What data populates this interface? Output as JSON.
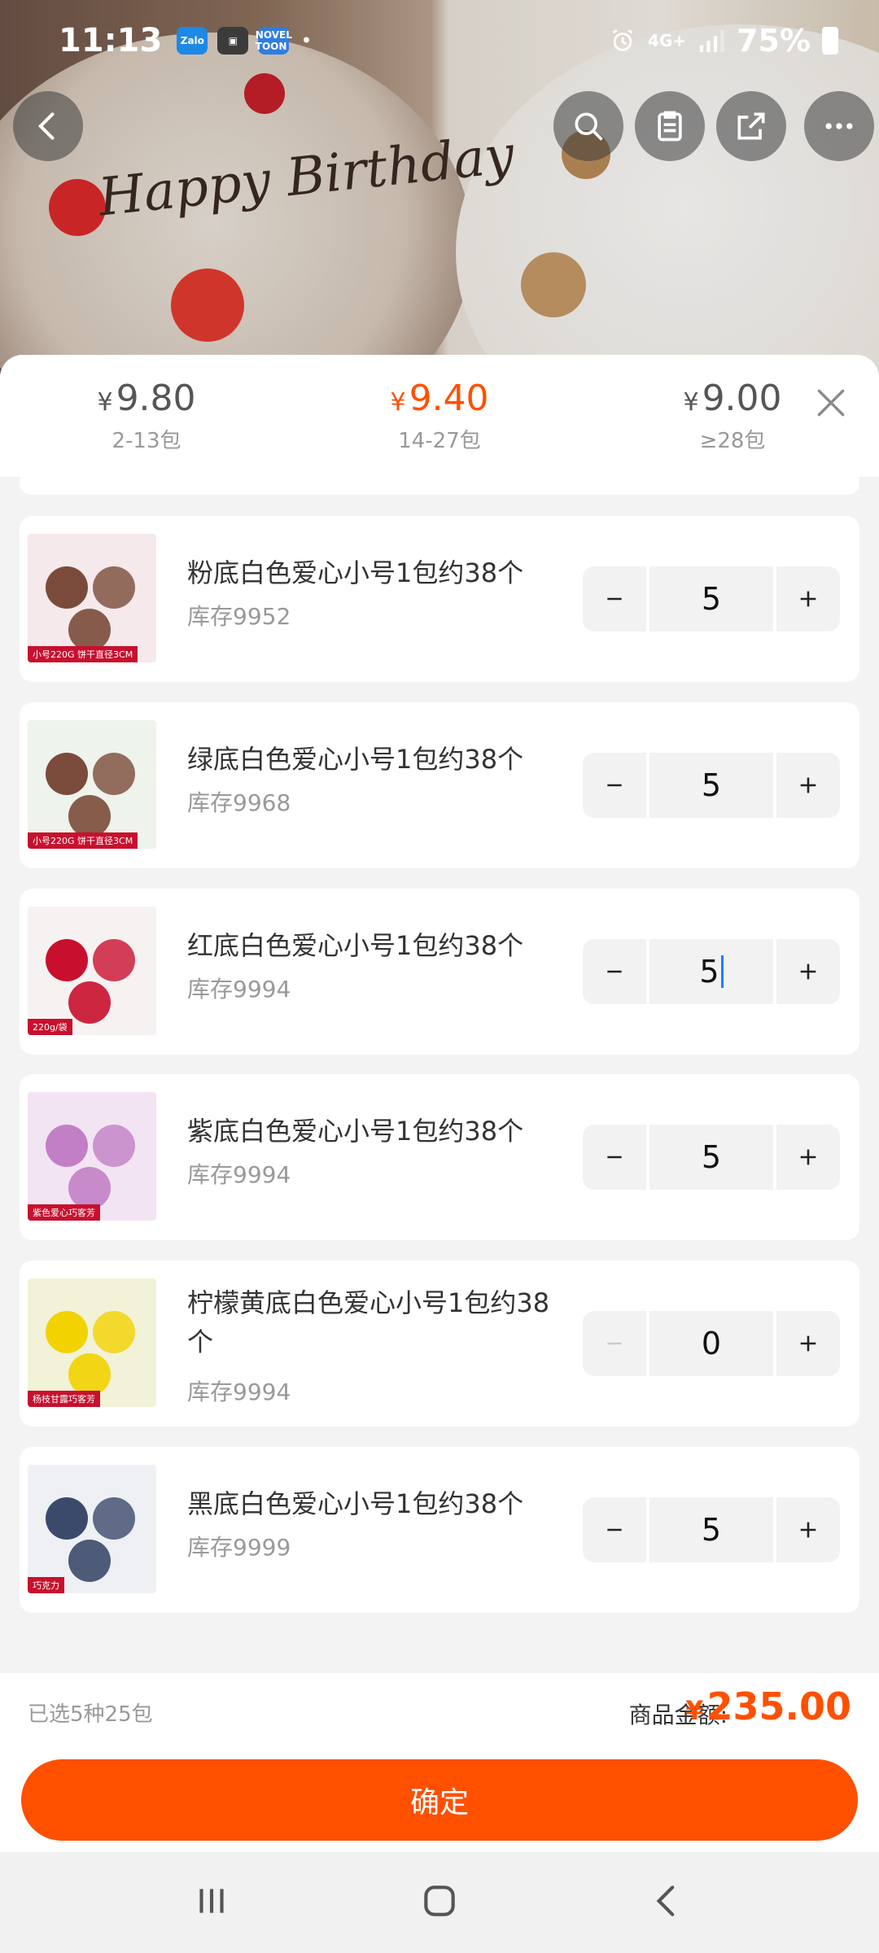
{
  "status_bar": {
    "time": "11:13",
    "apps": [
      {
        "name": "zalo-icon",
        "label": "Zalo",
        "color": "#1e88e5"
      },
      {
        "name": "gallery-icon",
        "label": "▣",
        "color": "#3b3b3b"
      },
      {
        "name": "noveltoon-icon",
        "label": "NOVEL TOON",
        "color": "#2f7de1"
      }
    ],
    "network": "4G+",
    "battery": "75%"
  },
  "price_tiers": [
    {
      "price": "9.80",
      "range": "2-13包",
      "active": false
    },
    {
      "price": "9.40",
      "range": "14-27包",
      "active": true
    },
    {
      "price": "9.00",
      "range": "≥28包",
      "active": false
    }
  ],
  "currency": "¥",
  "products": [
    {
      "name": "粉底白色爱心小号1包约38个",
      "stock": "库存9952",
      "qty": "5",
      "thumb_colors": [
        "#f5e9ec",
        "#7a4b3a"
      ],
      "tag": "小号220G 饼干直径3CM",
      "minus_disabled": false,
      "focused": false
    },
    {
      "name": "绿底白色爱心小号1包约38个",
      "stock": "库存9968",
      "qty": "5",
      "thumb_colors": [
        "#eef3ec",
        "#7a4b3a"
      ],
      "tag": "小号220G 饼干直径3CM",
      "minus_disabled": false,
      "focused": false
    },
    {
      "name": "红底白色爱心小号1包约38个",
      "stock": "库存9994",
      "qty": "5",
      "thumb_colors": [
        "#f7f2f2",
        "#c8102e"
      ],
      "tag": "220g/袋",
      "minus_disabled": false,
      "focused": true
    },
    {
      "name": "紫底白色爱心小号1包约38个",
      "stock": "库存9994",
      "qty": "5",
      "thumb_colors": [
        "#f2e4f2",
        "#c27fc6"
      ],
      "tag": "紫色爱心巧客芳",
      "minus_disabled": false,
      "focused": false
    },
    {
      "name": "柠檬黄底白色爱心小号1包约38个",
      "stock": "库存9994",
      "qty": "0",
      "thumb_colors": [
        "#f2f2d8",
        "#f2d200"
      ],
      "tag": "杨枝甘露巧客芳",
      "minus_disabled": true,
      "focused": false
    },
    {
      "name": "黑底白色爱心小号1包约38个",
      "stock": "库存9999",
      "qty": "5",
      "thumb_colors": [
        "#eef0f4",
        "#3b4a6b"
      ],
      "tag": "巧克力",
      "minus_disabled": false,
      "focused": false
    }
  ],
  "footer": {
    "selected": "已选5种25包",
    "total_label": "商品金额:",
    "total": "235.00",
    "confirm": "确定"
  },
  "hero_text": "Happy Birthday"
}
